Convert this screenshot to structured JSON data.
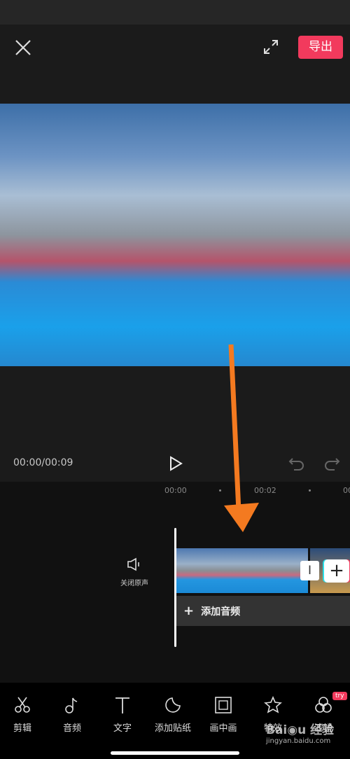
{
  "header": {
    "export_label": "导出"
  },
  "player": {
    "time": "00:00/00:09"
  },
  "timeline": {
    "ticks": [
      "00:00",
      "00:02",
      "00"
    ],
    "mute_label": "关闭原声",
    "add_audio_label": "添加音频",
    "add_audio_plus": "+",
    "transition_symbol": "I",
    "add_clip_symbol": "+"
  },
  "toolbar": {
    "items": [
      {
        "label": "剪辑",
        "icon": "scissors-icon"
      },
      {
        "label": "音频",
        "icon": "music-note-icon"
      },
      {
        "label": "文字",
        "icon": "text-icon"
      },
      {
        "label": "添加贴纸",
        "icon": "sticker-icon"
      },
      {
        "label": "画中画",
        "icon": "picture-in-picture-icon"
      },
      {
        "label": "特效",
        "icon": "star-effect-icon"
      },
      {
        "label": "滤镜",
        "icon": "filter-icon"
      }
    ],
    "try_badge": "try"
  },
  "watermark": "Baidu经验 jingyan.baidu.com",
  "colors": {
    "accent": "#f23a5d",
    "annotation_arrow": "#f47a20"
  }
}
